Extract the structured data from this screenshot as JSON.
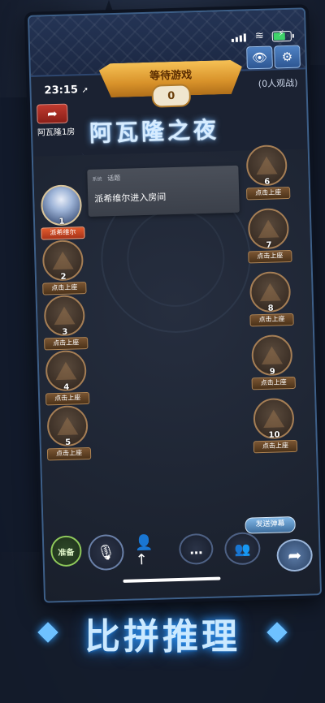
{
  "status": {
    "time": "23:15",
    "time_arrow": "➚",
    "wifi_glyph": "≋",
    "battery_level": 0.75
  },
  "header": {
    "banner_label": "等待游戏",
    "waiting_count": "0",
    "spectators": "(0人观战)",
    "back_icon": "back-arrow-icon",
    "eye_icon": "eye-icon",
    "gear_icon": "gear-icon",
    "room_name": "阿瓦隆1房",
    "game_title": "阿瓦隆之夜"
  },
  "chat": {
    "tag": "系统",
    "channel": "话题",
    "message": "派希维尔进入房间"
  },
  "seats_left": [
    {
      "num": "1",
      "label": "派希维尔",
      "occupied": true
    },
    {
      "num": "2",
      "label": "点击上座",
      "occupied": false
    },
    {
      "num": "3",
      "label": "点击上座",
      "occupied": false
    },
    {
      "num": "4",
      "label": "点击上座",
      "occupied": false
    },
    {
      "num": "5",
      "label": "点击上座",
      "occupied": false
    }
  ],
  "seats_right": [
    {
      "num": "6",
      "label": "点击上座",
      "occupied": false
    },
    {
      "num": "7",
      "label": "点击上座",
      "occupied": false
    },
    {
      "num": "8",
      "label": "点击上座",
      "occupied": false
    },
    {
      "num": "9",
      "label": "点击上座",
      "occupied": false
    },
    {
      "num": "10",
      "label": "点击上座",
      "occupied": false
    }
  ],
  "controls": {
    "send_danmu": "发送弹幕",
    "ready": "准备",
    "mic_glyph": "🎙",
    "add_friend_glyph": "👤↑",
    "chat_glyph": "…",
    "group_glyph": "👥",
    "share_glyph": "➦"
  },
  "tagline": "比拼推理",
  "colors": {
    "accent_blue": "#6ec1ff",
    "banner_gold": "#f6c155",
    "occupied_label": "#e35b2d"
  }
}
